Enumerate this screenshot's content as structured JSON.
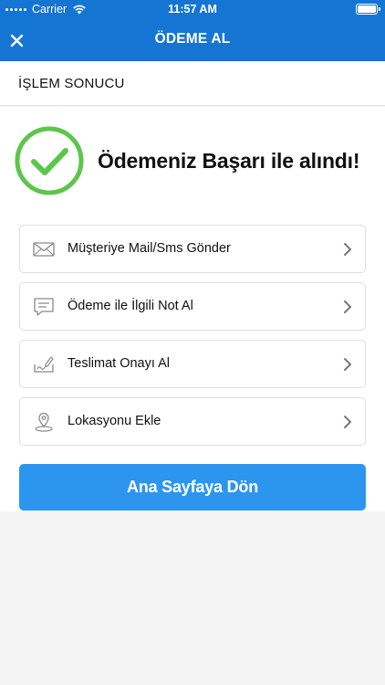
{
  "status_bar": {
    "carrier": "Carrier",
    "time": "11:57 AM"
  },
  "nav": {
    "title": "ÖDEME AL",
    "close_icon": "close-icon"
  },
  "section": {
    "title": "İŞLEM SONUCU"
  },
  "result": {
    "message": "Ödemeniz Başarı ile alındı!",
    "icon": "check-circle-icon",
    "color": "#5cc64b"
  },
  "actions": [
    {
      "label": "Müşteriye Mail/Sms Gönder",
      "icon": "envelope-icon"
    },
    {
      "label": "Ödeme ile İlgili Not Al",
      "icon": "note-icon"
    },
    {
      "label": "Teslimat Onayı Al",
      "icon": "signature-icon"
    },
    {
      "label": "Lokasyonu Ekle",
      "icon": "location-pin-icon"
    }
  ],
  "home_button": {
    "label": "Ana Sayfaya Dön",
    "color": "#2c96ef"
  },
  "colors": {
    "header": "#1476d2",
    "background": "#f4f4f4"
  }
}
